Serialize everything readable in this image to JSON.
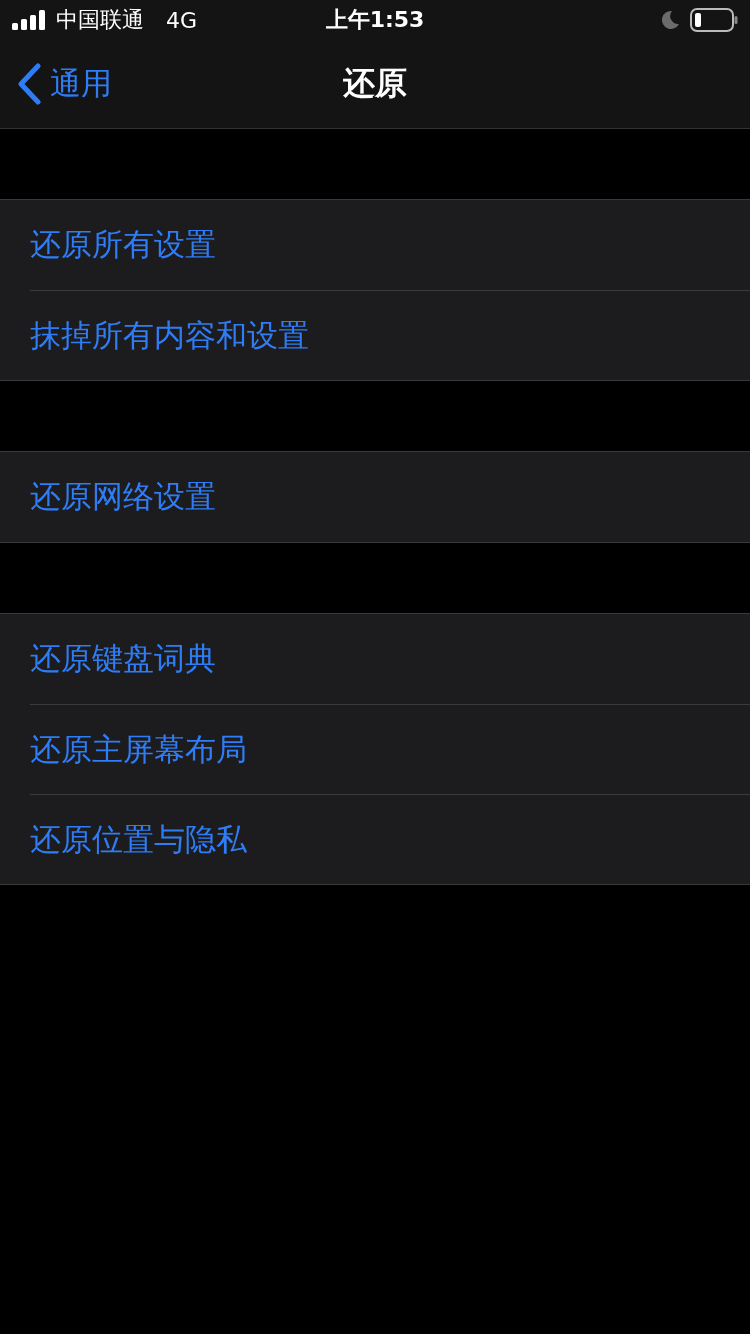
{
  "status_bar": {
    "carrier": "中国联通",
    "network": "4G",
    "time": "上午1:53"
  },
  "nav": {
    "back": "通用",
    "title": "还原"
  },
  "groups": [
    {
      "items": [
        "还原所有设置",
        "抹掉所有内容和设置"
      ]
    },
    {
      "items": [
        "还原网络设置"
      ]
    },
    {
      "items": [
        "还原键盘词典",
        "还原主屏幕布局",
        "还原位置与隐私"
      ]
    }
  ]
}
